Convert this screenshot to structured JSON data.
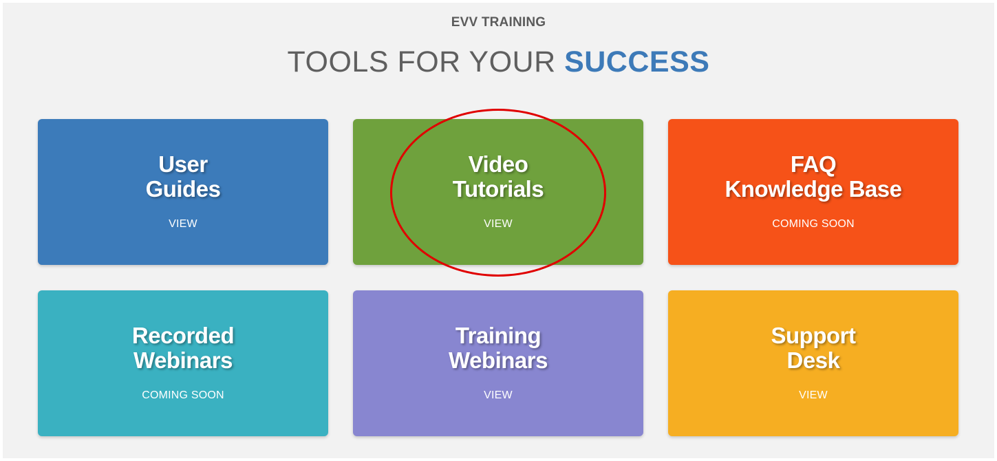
{
  "header": {
    "eyebrow": "EVV TRAINING",
    "headline_prefix": "TOOLS FOR YOUR ",
    "headline_accent": "SUCCESS"
  },
  "cards": [
    {
      "title_line1": "User",
      "title_line2": "Guides",
      "action": "VIEW",
      "color": "#3c7bba"
    },
    {
      "title_line1": "Video",
      "title_line2": "Tutorials",
      "action": "VIEW",
      "color": "#6fa13d"
    },
    {
      "title_line1": "FAQ",
      "title_line2": "Knowledge Base",
      "action": "COMING SOON",
      "color": "#f65218"
    },
    {
      "title_line1": "Recorded",
      "title_line2": "Webinars",
      "action": "COMING SOON",
      "color": "#3ab1c1"
    },
    {
      "title_line1": "Training",
      "title_line2": "Webinars",
      "action": "VIEW",
      "color": "#8886d0"
    },
    {
      "title_line1": "Support",
      "title_line2": "Desk",
      "action": "VIEW",
      "color": "#f6ae22"
    }
  ],
  "colors": {
    "accent": "#3d7ab8",
    "annotation": "#e00000",
    "background": "#f2f2f2"
  }
}
